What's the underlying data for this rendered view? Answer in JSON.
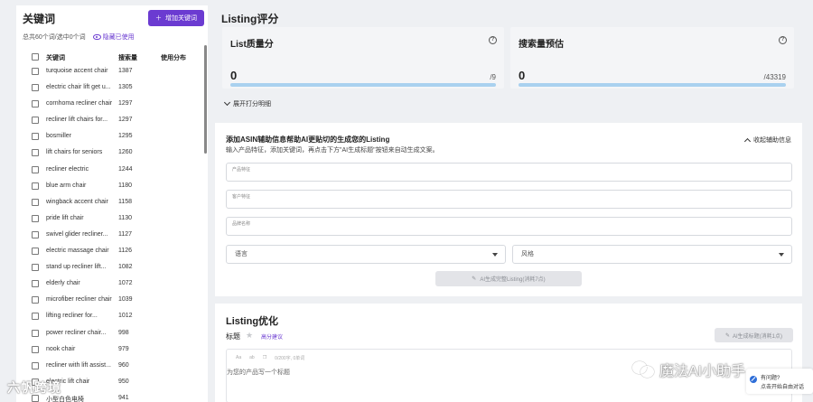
{
  "keywords_panel": {
    "title": "关键词",
    "add_button": "增加关键词",
    "summary": "总共60个词/选中0个词",
    "hide_used": "隐藏已使用",
    "columns": [
      "关键词",
      "搜索量",
      "使用分布"
    ],
    "rows": [
      {
        "keyword": "turquoise accent chair",
        "volume": "1387"
      },
      {
        "keyword": "electric chair lift get u...",
        "volume": "1305"
      },
      {
        "keyword": "cornhoma recliner chair",
        "volume": "1297"
      },
      {
        "keyword": "recliner lift chairs for...",
        "volume": "1297"
      },
      {
        "keyword": "bosmiller",
        "volume": "1295"
      },
      {
        "keyword": "lift chairs for seniors",
        "volume": "1260"
      },
      {
        "keyword": "recliner electric",
        "volume": "1244"
      },
      {
        "keyword": "blue arm chair",
        "volume": "1180"
      },
      {
        "keyword": "wingback accent chair",
        "volume": "1158"
      },
      {
        "keyword": "pride lift chair",
        "volume": "1130"
      },
      {
        "keyword": "swivel glider recliner...",
        "volume": "1127"
      },
      {
        "keyword": "electric massage chair",
        "volume": "1126"
      },
      {
        "keyword": "stand up recliner lift...",
        "volume": "1082"
      },
      {
        "keyword": "elderly chair",
        "volume": "1072"
      },
      {
        "keyword": "microfiber recliner chair",
        "volume": "1039"
      },
      {
        "keyword": "lifting recliner for...",
        "volume": "1012"
      },
      {
        "keyword": "power recliner chair...",
        "volume": "998"
      },
      {
        "keyword": "nook chair",
        "volume": "979"
      },
      {
        "keyword": "recliner with lift assist...",
        "volume": "960"
      },
      {
        "keyword": "electric lift chair",
        "volume": "950"
      },
      {
        "keyword": "小型白色电椅",
        "volume": "941"
      }
    ]
  },
  "listing_score": {
    "title": "Listing评分",
    "quality": {
      "label": "List质量分",
      "value": "0",
      "max": "/9",
      "progress": 0
    },
    "search": {
      "label": "搜索量预估",
      "value": "0",
      "max": "/43319",
      "progress": 0
    },
    "expand_label": "展开打分明细"
  },
  "asin_helper": {
    "title": "添加ASIN辅助信息帮助AI更贴切的生成您的Listing",
    "desc": "输入产品特征，添加关键词，再点击下方\"AI生成标题\"按钮来自动生成文案。",
    "collapse_label": "收起辅助信息",
    "fields": [
      "产品特征",
      "客户特征",
      "品牌名称"
    ],
    "language_placeholder": "语言",
    "style_placeholder": "风格",
    "generate_button": "AI生成完整Listing(消耗7点)"
  },
  "listing_optimize": {
    "title": "Listing优化",
    "tag_label": "标题",
    "tips_label": "高分建议",
    "ai_title_button": "AI生成标题(消耗1点)",
    "editor_tools": [
      "Aa",
      "ab",
      "0/200字, 0单词"
    ],
    "placeholder": "为您的产品写一个标题"
  },
  "watermarks": {
    "left": "六帆跨境",
    "right": "魔法AI小助手"
  },
  "help_widget": {
    "line1": "有问题?",
    "line2": "点击开始自由对话"
  },
  "colors": {
    "accent": "#6b3bd1",
    "progress_track": "#a9d1ef",
    "progress_fill": "#2f7fd6"
  }
}
